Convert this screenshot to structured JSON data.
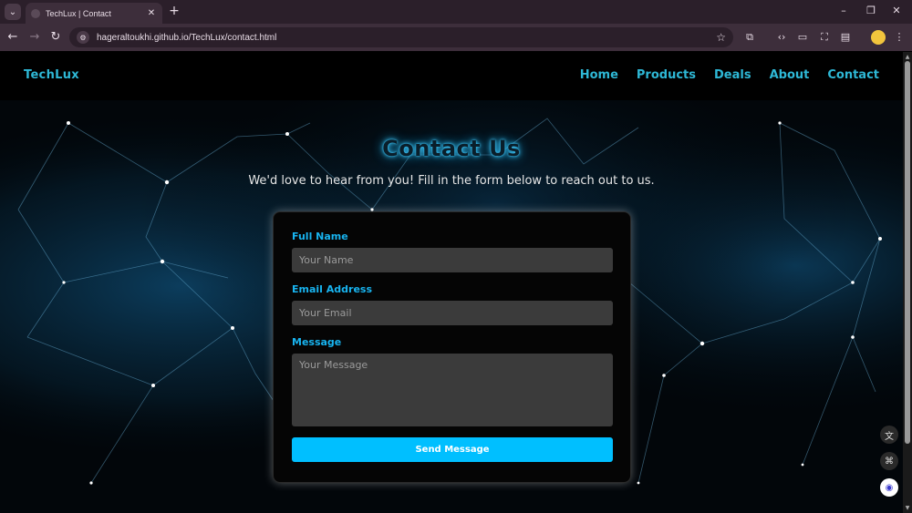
{
  "browser": {
    "tab_title": "TechLux | Contact",
    "url": "hageraltoukhi.github.io/TechLux/contact.html"
  },
  "site": {
    "brand": "TechLux",
    "nav": [
      "Home",
      "Products",
      "Deals",
      "About",
      "Contact"
    ],
    "active_nav": "Contact"
  },
  "hero": {
    "title": "Contact Us",
    "subtitle": "We'd love to hear from you! Fill in the form below to reach out to us."
  },
  "form": {
    "name_label": "Full Name",
    "name_placeholder": "Your Name",
    "email_label": "Email Address",
    "email_placeholder": "Your Email",
    "message_label": "Message",
    "message_placeholder": "Your Message",
    "submit_label": "Send Message"
  },
  "colors": {
    "accent": "#00bfff",
    "nav_text": "#2eb8d6",
    "label_text": "#18b4f0"
  },
  "icons": {
    "tab_menu": "chevron-down-icon",
    "back": "arrow-left-icon",
    "forward": "arrow-right-icon",
    "reload": "reload-icon",
    "bookmark": "star-icon",
    "extensions": "puzzle-icon",
    "floating": [
      "translate-icon",
      "grid-icon",
      "assistant-icon"
    ]
  }
}
